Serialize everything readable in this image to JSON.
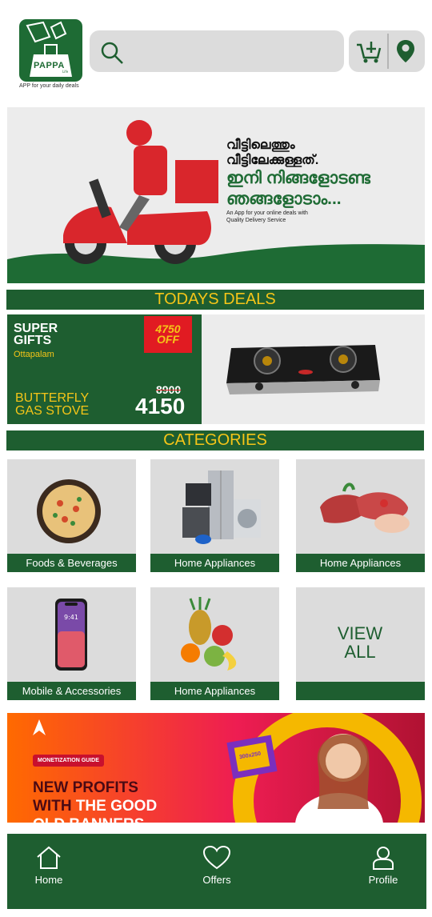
{
  "header": {
    "logo_text": "PAPPA",
    "logo_sub": "Life",
    "tagline": "APP for your daily deals",
    "search": {
      "placeholder": "",
      "icon": "search-icon"
    },
    "cart_icon": "cart-icon",
    "location_icon": "location-pin-icon"
  },
  "hero": {
    "line1": "വീട്ടിലെത്തും",
    "line2": "വീട്ടിലേക്കുള്ളത്.",
    "line3": "ഇനി നിങ്ങളോടണ്ട",
    "line4": "ഞങ്ങളോടാം...",
    "sub": "An App for your online deals with Quality Delivery Service"
  },
  "todays_deals": {
    "title": "TODAYS DEALS",
    "store_name": "SUPER GIFTS",
    "store_location": "Ottapalam",
    "offer": "4750 OFF",
    "product": "BUTTERFLY GAS STOVE",
    "old_price": "8900",
    "new_price": "4150"
  },
  "categories": {
    "title": "CATEGORIES",
    "items": [
      {
        "label": "Foods & Beverages",
        "icon": "food-plate-icon"
      },
      {
        "label": "Home Appliances",
        "icon": "appliances-icon"
      },
      {
        "label": "Home Appliances",
        "icon": "meat-icon"
      },
      {
        "label": "Mobile & Accessories",
        "icon": "smartphone-icon"
      },
      {
        "label": "Home Appliances",
        "icon": "fruits-icon"
      }
    ],
    "view_all": "VIEW ALL"
  },
  "ad_banner": {
    "badge": "MONETIZATION GUIDE",
    "line1": "NEW PROFITS",
    "line2a": "WITH ",
    "line2b": "THE GOOD",
    "line3": "OLD BANNERS",
    "sticker": "300x250"
  },
  "nav": {
    "home": "Home",
    "offers": "Offers",
    "profile": "Profile"
  },
  "colors": {
    "brand_green": "#1e5e30",
    "accent_yellow": "#f5c518",
    "offer_red": "#e11b22"
  }
}
